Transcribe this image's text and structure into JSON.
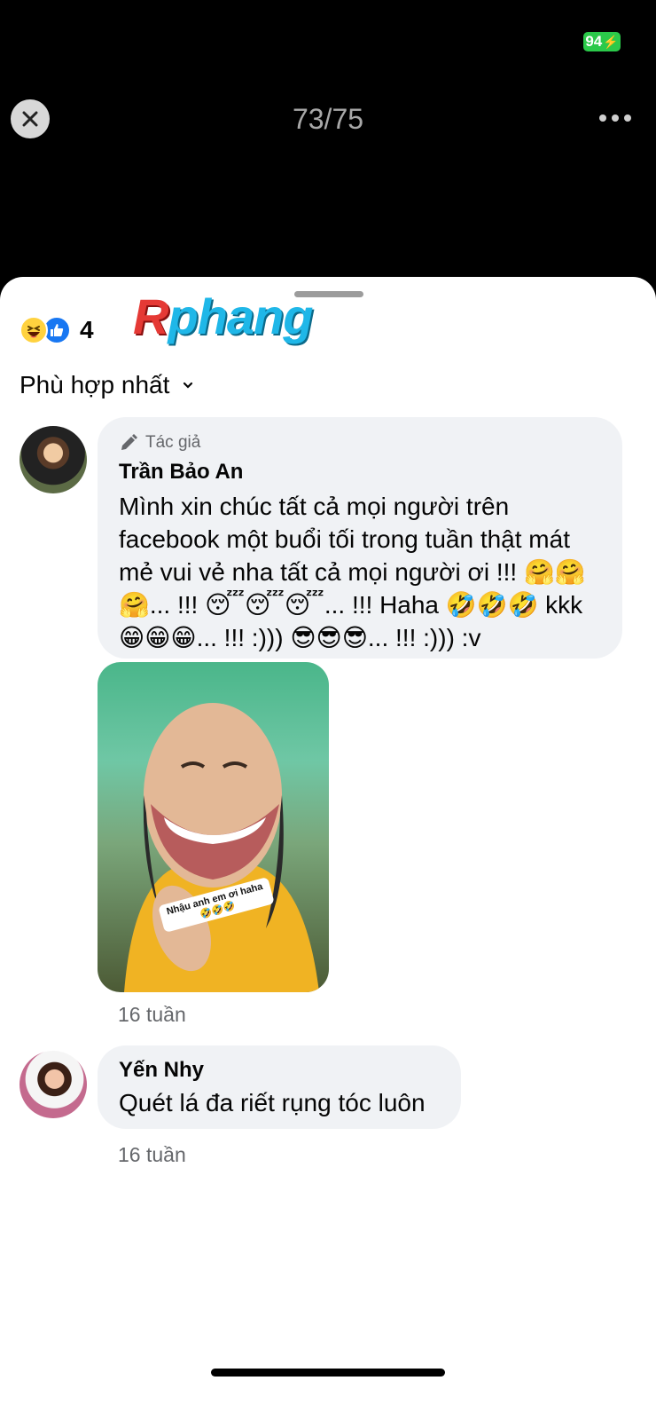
{
  "status": {
    "battery": "94"
  },
  "header": {
    "counter": "73/75"
  },
  "reactions": {
    "icons": [
      "haha-reaction-icon",
      "like-reaction-icon"
    ],
    "count": "4"
  },
  "sort": {
    "label": "Phù hợp nhất"
  },
  "comments": [
    {
      "badge": "Tác giả",
      "name": "Trần Bảo An",
      "text": "Mình xin chúc tất cả mọi người trên facebook một buổi tối trong tuần thật mát mẻ vui vẻ nha tất cả mọi người ơi !!! 🤗🤗🤗... !!! 😴😴😴... !!! Haha 🤣🤣🤣 kkk 😁😁😁... !!! :))) 😎😎😎... !!! :))) :v",
      "image": {
        "watermark_r": "R",
        "watermark_rest": "phang",
        "sticker_line1": "Nhậu anh em ơi haha",
        "sticker_line2": "🤣🤣🤣"
      },
      "time": "16 tuần"
    },
    {
      "name": "Yến Nhy",
      "text": "Quét lá đa riết rụng tóc luôn",
      "time": "16 tuần"
    }
  ],
  "colors": {
    "sheet_bg": "#ffffff",
    "bubble_bg": "#f0f2f5",
    "like_blue": "#1877f2",
    "battery_green": "#2bc94a"
  }
}
